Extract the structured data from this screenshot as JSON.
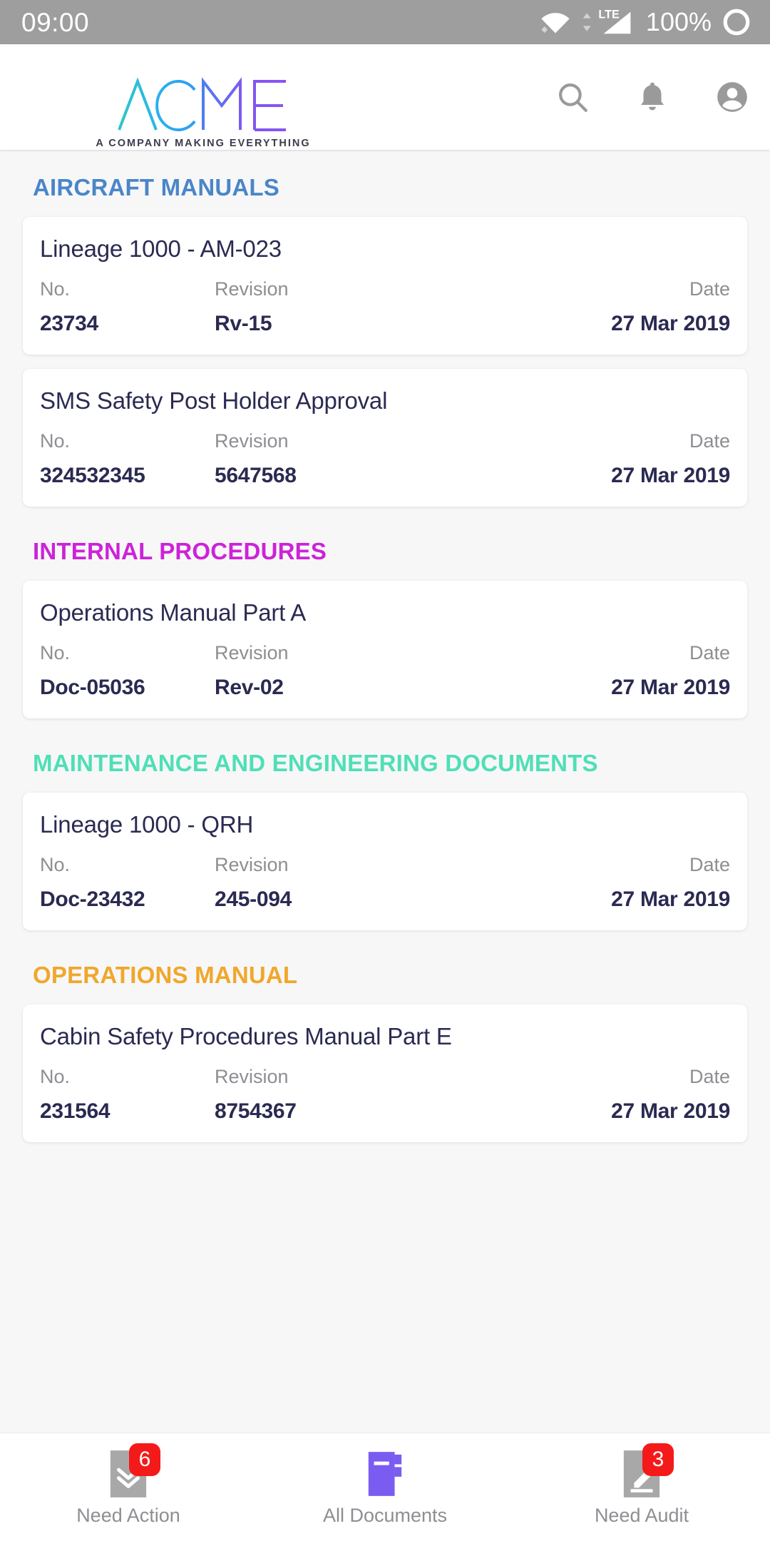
{
  "status_bar": {
    "time": "09:00",
    "battery_percent": "100%",
    "network_label": "LTE",
    "icons": [
      "wifi-icon",
      "lte-signal-icon",
      "battery-icon"
    ]
  },
  "header": {
    "brand_name": "ACME",
    "brand_letters": [
      "A",
      "C",
      "M",
      "E"
    ],
    "tagline": "A COMPANY MAKING EVERYTHING",
    "actions": [
      {
        "name": "search-icon",
        "label": "Search"
      },
      {
        "name": "notifications-bell-icon",
        "label": "Notifications"
      },
      {
        "name": "account-avatar-icon",
        "label": "Account"
      }
    ]
  },
  "columns": {
    "no": "No.",
    "revision": "Revision",
    "date": "Date"
  },
  "sections": [
    {
      "title": "AIRCRAFT MANUALS",
      "color": "#4a86c8",
      "documents": [
        {
          "title": "Lineage 1000 - AM-023",
          "no": "23734",
          "revision": "Rv-15",
          "date": "27 Mar 2019"
        },
        {
          "title": "SMS Safety Post Holder Approval",
          "no": "324532345",
          "revision": "5647568",
          "date": "27 Mar 2019"
        }
      ]
    },
    {
      "title": "INTERNAL PROCEDURES",
      "color": "#cc23d8",
      "documents": [
        {
          "title": "Operations Manual Part A",
          "no": "Doc-05036",
          "revision": "Rev-02",
          "date": "27 Mar 2019"
        }
      ]
    },
    {
      "title": "MAINTENANCE AND ENGINEERING DOCUMENTS",
      "color": "#4fdfb6",
      "documents": [
        {
          "title": "Lineage 1000 - QRH",
          "no": "Doc-23432",
          "revision": "245-094",
          "date": "27 Mar 2019"
        }
      ]
    },
    {
      "title": "OPERATIONS MANUAL",
      "color": "#f0a72b",
      "documents": [
        {
          "title": "Cabin Safety Procedures Manual Part E",
          "no": "231564",
          "revision": "8754367",
          "date": "27 Mar 2019"
        }
      ]
    }
  ],
  "bottom_nav": {
    "items": [
      {
        "label": "Need Action",
        "icon": "document-double-chevron-down-icon",
        "badge": "6",
        "active": false
      },
      {
        "label": "All Documents",
        "icon": "book-icon",
        "badge": "",
        "active": true
      },
      {
        "label": "Need Audit",
        "icon": "document-pencil-icon",
        "badge": "3",
        "active": false
      }
    ],
    "active_color": "#7b5cf0",
    "inactive_color": "#a8a8a8",
    "badge_color": "#f41a1a"
  }
}
